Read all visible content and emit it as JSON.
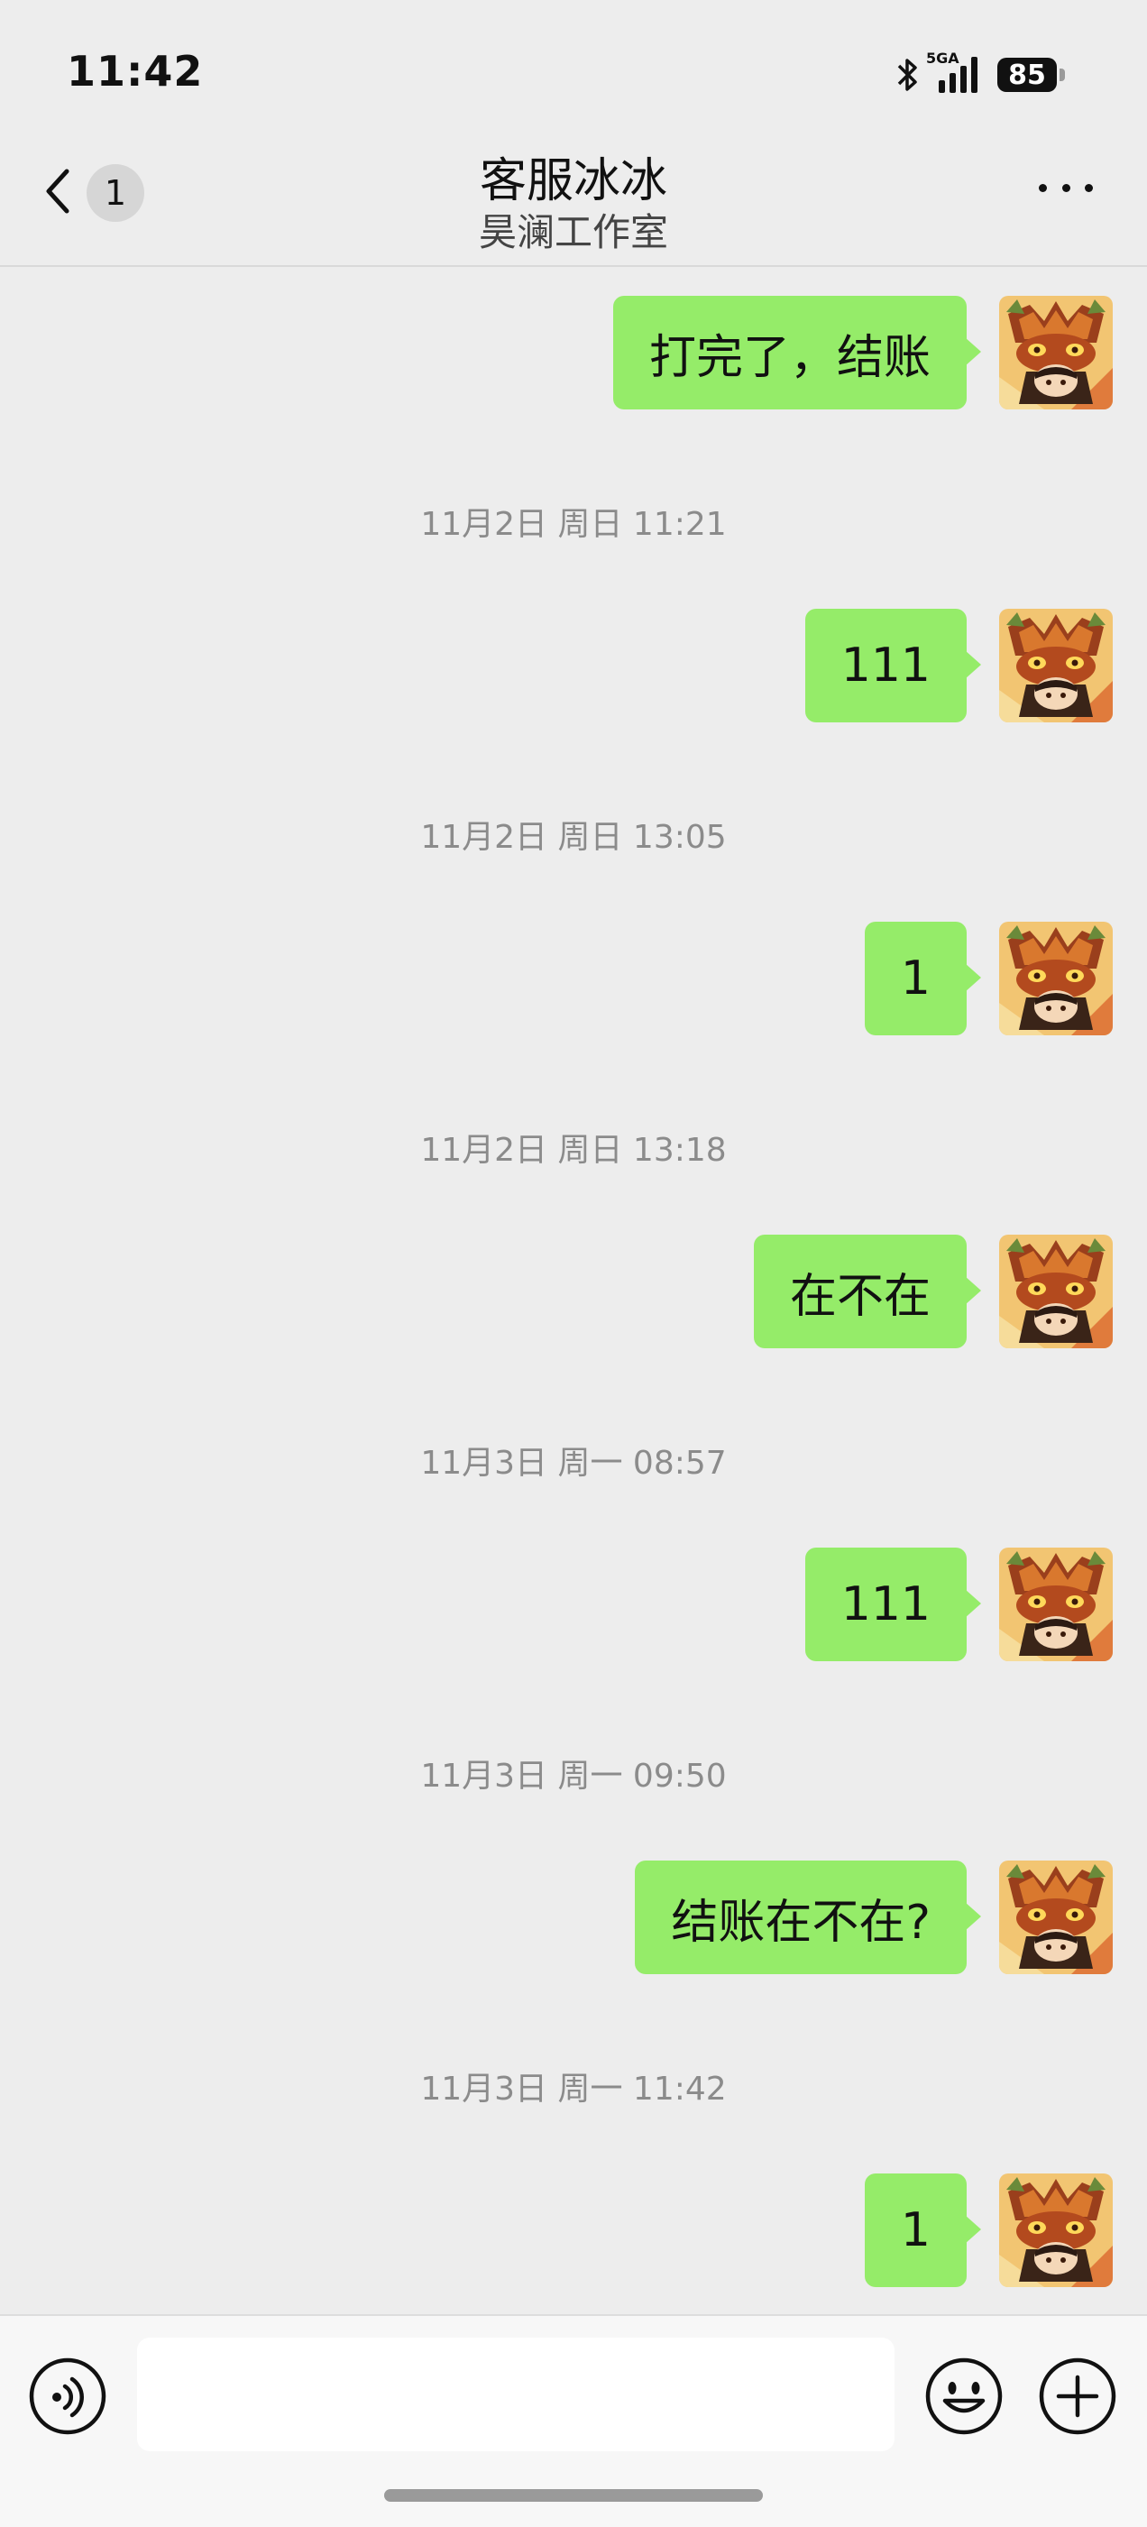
{
  "status_bar": {
    "time": "11:42",
    "network": "5GA",
    "battery": "85"
  },
  "header": {
    "back_count": "1",
    "title": "客服冰冰",
    "subtitle": "昊澜工作室"
  },
  "messages": [
    {
      "text": "打完了，结账"
    },
    {
      "timestamp": "11月2日 周日 11:21",
      "text": "111"
    },
    {
      "timestamp": "11月2日 周日 13:05",
      "text": "1"
    },
    {
      "timestamp": "11月2日 周日 13:18",
      "text": "在不在"
    },
    {
      "timestamp": "11月3日 周一 08:57",
      "text": "111"
    },
    {
      "timestamp": "11月3日 周一 09:50",
      "text": "结账在不在?"
    },
    {
      "timestamp": "11月3日 周一 11:42",
      "text": "1"
    }
  ],
  "colors": {
    "background": "#ededed",
    "bubble_self": "#95ec69",
    "timestamp_text": "#8b8b8b"
  },
  "icons": {
    "voice": "voice-icon",
    "emoji": "emoji-icon",
    "more": "plus-icon"
  }
}
